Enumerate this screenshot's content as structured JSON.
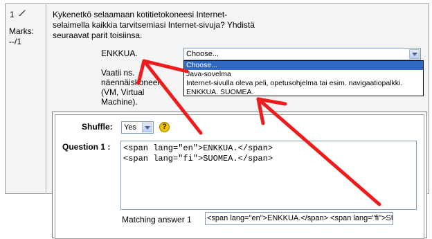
{
  "question": {
    "number": "1",
    "marks_label": "Marks:",
    "marks_value": "--/1",
    "text": "Kykenetkö selaamaan kotitietokoneesi Internet-selaimella kaikkia tarvitsemiasi Internet-sivuja? Yhdistä seuraavat parit toisiinsa.",
    "subquestion_1": "ENKKUA.",
    "subquestion_2": "Vaatii ns. näennäiskoneen (VM, Virtual Machine)."
  },
  "answer_select": {
    "value": "Choose...",
    "options": [
      "Choose...",
      "Java-sovelma",
      "Internet-sivulla oleva peli, opetusohjelma tai esim. navigaatiopalkki.",
      "ENKKUA. SUOMEA."
    ]
  },
  "editor": {
    "shuffle_label": "Shuffle:",
    "shuffle_value": "Yes",
    "help_icon": "?",
    "question1_label": "Question 1 :",
    "question1_line1": "<span lang=\"en\">ENKKUA.</span>",
    "question1_line2": "<span lang=\"fi\">SUOMEA.</span>",
    "matching_label": "Matching answer 1",
    "matching_value": "<span lang=\"en\">ENKKUA.</span> <span lang=\"fi\">SU"
  },
  "icons": {
    "edit": "edit-icon",
    "help": "help-icon",
    "dropdown": "chevron-down-icon"
  },
  "colors": {
    "annotation_arrow": "#ee1c1c",
    "selected_option_bg": "#316ac5"
  }
}
